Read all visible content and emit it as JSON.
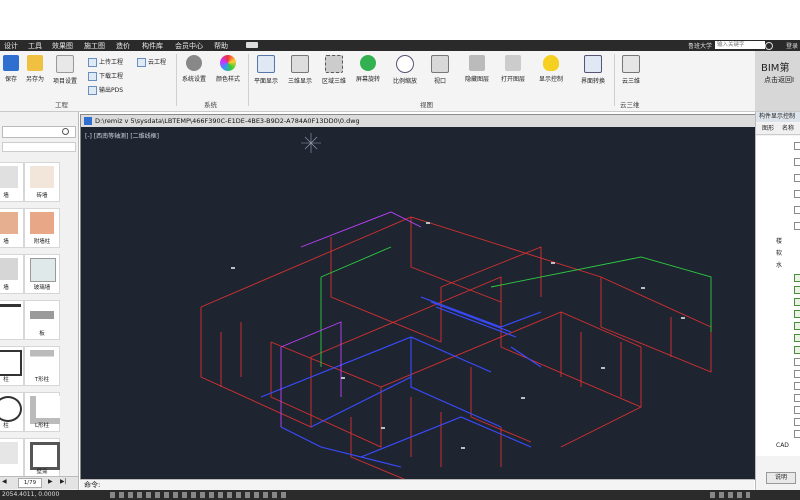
{
  "menu": {
    "items": [
      "设计",
      "工具",
      "效果图",
      "施工图",
      "造价",
      "构件库",
      "会员中心",
      "帮助"
    ],
    "search_placeholder": "输入关键字",
    "cloud_label": "鲁班大学",
    "login_label": "登录"
  },
  "ribbon": {
    "buttons": [
      "保存",
      "另存为",
      "项目设置",
      "系统设置",
      "颜色样式",
      "平面显示",
      "三维显示",
      "区域三维",
      "屏幕旋转",
      "比例缩放",
      "视口",
      "隐藏图层",
      "打开图层",
      "显示控制",
      "界面转换",
      "云三维"
    ],
    "small_buttons": [
      "上传工程",
      "云工程",
      "下载工程",
      "输出PDS"
    ],
    "groups": [
      "工程",
      "系统",
      "视图",
      "云三维"
    ],
    "bim_title": "BIM第",
    "bim_sub": "点击返回I"
  },
  "left_panel": {
    "pager": "1/79",
    "tiles": [
      "墙",
      "砖墙",
      "墙",
      "附墙柱",
      "墙",
      "玻璃墙",
      "",
      "板",
      "柱",
      "T形柱",
      "柱",
      "L形柱",
      "",
      "壁龛"
    ]
  },
  "canvas": {
    "title": "D:\\remiz v 5\\sysdata\\LBTEMP\\466F390C-E1DE-4BE3-B9D2-A784A0F13DD0\\0.dwg",
    "view_label": "[-] [西南等轴测] [二维线框]"
  },
  "command": {
    "label": "命令:"
  },
  "status": {
    "coords": "2054.4011,  0.0000"
  },
  "right_panel": {
    "title": "构件显示控制",
    "col1": "图形",
    "col2": "名称",
    "tree_items": [
      "楼",
      "软",
      "水",
      "CAD"
    ],
    "button": "说明"
  },
  "colors": {
    "canvas_bg": "#1e2531",
    "menubar": "#2a2a2a",
    "accent_red": "#e03030",
    "accent_blue": "#3a4bff",
    "accent_green": "#2ecc40",
    "accent_magenta": "#c040ff"
  }
}
